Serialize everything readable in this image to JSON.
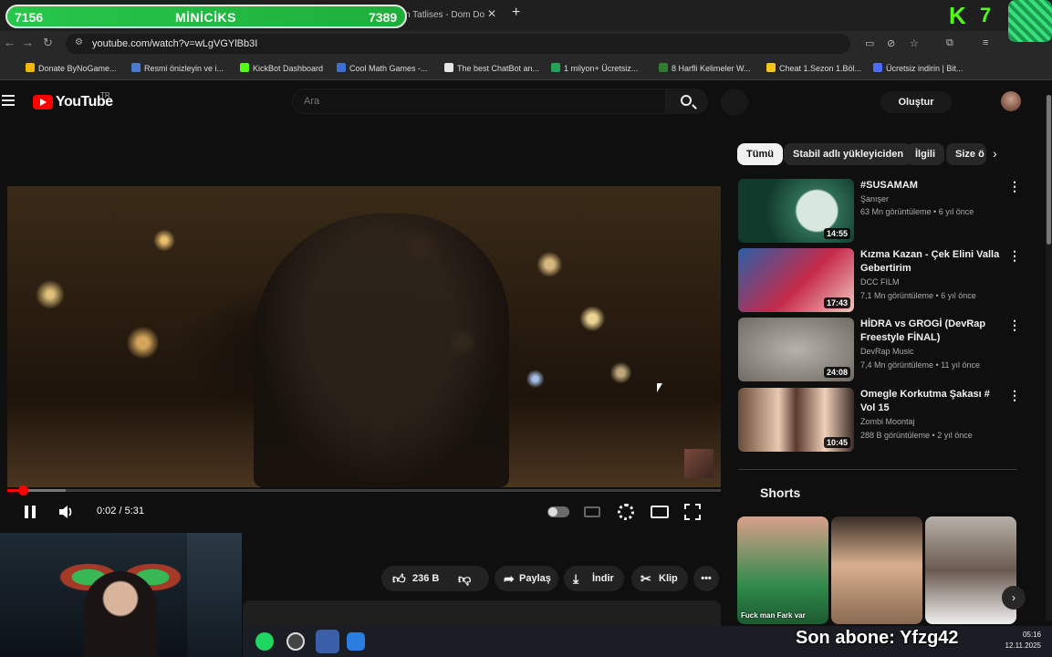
{
  "overlay": {
    "sub_left": "7156",
    "sub_title": "MİNİCİKS",
    "sub_right": "7389",
    "kick_count": "7",
    "last_sub": "Son abone: Yfzg42"
  },
  "browser": {
    "tab_title": "n Tatlises - Dom Do",
    "url": "youtube.com/watch?v=wLgVGYlBb3I",
    "bookmarks": [
      {
        "label": "Donate ByNoGame...",
        "color": "#f2b900"
      },
      {
        "label": "Resmi önizleyin ve i...",
        "color": "#4a7bd0"
      },
      {
        "label": "KickBot Dashboard",
        "color": "#53fc18"
      },
      {
        "label": "Cool Math Games -...",
        "color": "#3b6fd6"
      },
      {
        "label": "The best ChatBot an...",
        "color": "#e6e6e6"
      },
      {
        "label": "1 milyon+ Ücretsiz...",
        "color": "#22a559"
      },
      {
        "label": "8 Harfli Kelimeler W...",
        "color": "#2e7d32"
      },
      {
        "label": "Cheat 1.Sezon 1.Böl...",
        "color": "#f5c518"
      },
      {
        "label": "Ücretsiz indirin | Bit...",
        "color": "#4d6bff"
      }
    ]
  },
  "youtube": {
    "logo_text": "YouTube",
    "region": "TR",
    "search_placeholder": "Ara",
    "create_label": "Oluştur",
    "player": {
      "time": "0:02 / 5:31",
      "progress": 0.006
    },
    "actions": {
      "likes": "236 B",
      "share": "Paylaş",
      "download": "İndir",
      "clip": "Klip"
    },
    "chips": [
      "Tümü",
      "Stabil adlı yükleyiciden",
      "İlgili",
      "Size ö"
    ],
    "recommendations": [
      {
        "title": "#SUSAMAM",
        "channel": "Şanışer",
        "meta": "63 Mn görüntüleme • 6 yıl önce",
        "duration": "14:55"
      },
      {
        "title": "Kızma Kazan - Çek Elini Valla Gebertirim",
        "channel": "DCC FILM",
        "meta": "7,1 Mn görüntüleme • 6 yıl önce",
        "duration": "17:43"
      },
      {
        "title": "HİDRA vs GROGİ (DevRap Freestyle FİNAL)",
        "channel": "DevRap Music",
        "meta": "7,4 Mn görüntüleme • 11 yıl önce",
        "duration": "24:08"
      },
      {
        "title": "Omegle Korkutma Şakası # Vol 15",
        "channel": "Zombi Moontaj",
        "meta": "288 B görüntüleme • 2 yıl önce",
        "duration": "10:45"
      }
    ],
    "shorts_title": "Shorts",
    "shorts": [
      {
        "caption": "Fuck man Fark var"
      },
      {
        "caption": ""
      },
      {
        "caption": ""
      }
    ]
  },
  "system": {
    "clock_time": "05:16",
    "clock_date": "12.11.2025"
  }
}
